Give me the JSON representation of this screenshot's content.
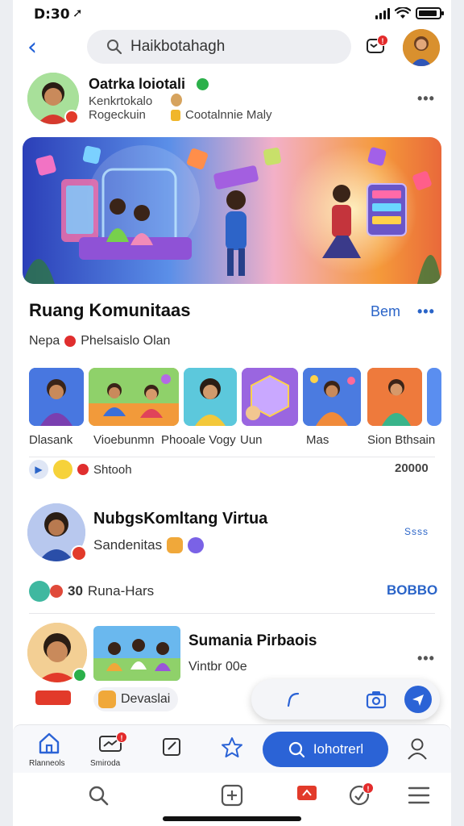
{
  "status_bar": {
    "time": "D:30"
  },
  "search": {
    "text": "Haikbotahagh"
  },
  "notifications": {
    "badge": "!"
  },
  "profile": {
    "name": "Oatrka loiotali",
    "line1": "Kenkrtokalo",
    "line2": "Rogeckuin",
    "line2_extra": "Cootalnnie Maly"
  },
  "community": {
    "title": "Ruang Komunitaas",
    "action": "Bem",
    "subtitle_a": "Nepa",
    "subtitle_b": "Phelsaislo Olan",
    "items": [
      {
        "label": "Dlasank"
      },
      {
        "label": "Vioebunmn"
      },
      {
        "label": "Phooale Vogy"
      },
      {
        "label": "Uun"
      },
      {
        "label": "Mas"
      },
      {
        "label": "Sion Bthsain"
      }
    ],
    "footer_left": "Shtooh",
    "footer_right": "20000"
  },
  "post1": {
    "title": "NubgsKomltang Virtua",
    "subtitle": "Sandenitas",
    "meta": "Ssss",
    "footer_count": "30",
    "footer_text": "Runa-Hars",
    "footer_right": "BOBBO"
  },
  "post2": {
    "title": "Sumania Pirbaois",
    "subtitle": "Vintbr 00e",
    "chip": "Devaslai"
  },
  "tabbar": {
    "home_label": "Rlanneols",
    "messages_label": "Smiroda",
    "messages_badge": "!",
    "cta_label": "Iohotrerl"
  },
  "bottom_badge": "!",
  "colors": {
    "accent": "#2b63d6",
    "badge": "#e32b2b"
  }
}
